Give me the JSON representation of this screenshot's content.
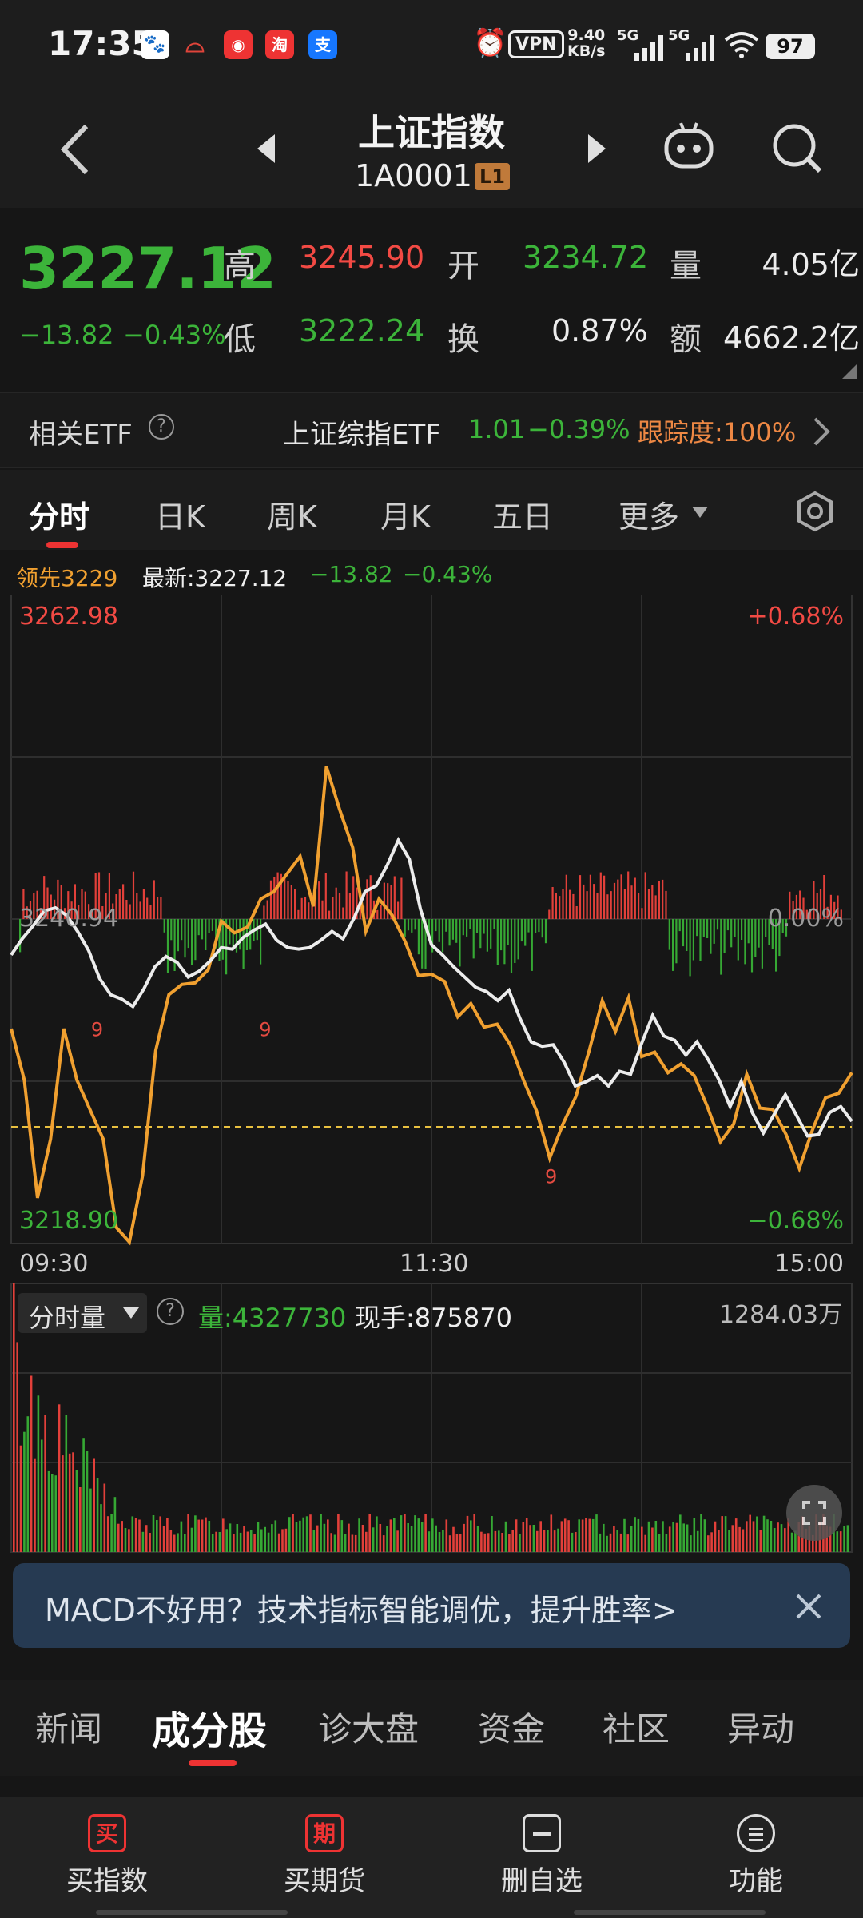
{
  "status_bar": {
    "time": "17:35",
    "vpn": "VPN",
    "net_speed_top": "9.40",
    "net_speed_bottom": "KB/s",
    "battery": "97",
    "net1": "5G",
    "net2": "5G"
  },
  "header": {
    "title": "上证指数",
    "code": "1A0001",
    "level_badge": "L1"
  },
  "quote": {
    "price": "3227.12",
    "change": "−13.82",
    "change_pct": "−0.43%",
    "high_label": "高",
    "high": "3245.90",
    "open_label": "开",
    "open": "3234.72",
    "volume_label": "量",
    "volume": "4.05亿",
    "low_label": "低",
    "low": "3222.24",
    "turnover_label": "换",
    "turnover": "0.87%",
    "amount_label": "额",
    "amount": "4662.2亿"
  },
  "etf": {
    "label": "相关ETF",
    "name": "上证综指ETF",
    "price": "1.01",
    "pct": "−0.39%",
    "tracking": "跟踪度:100%"
  },
  "tabs": [
    "分时",
    "日K",
    "周K",
    "月K",
    "五日",
    "更多"
  ],
  "chart_info": {
    "leading": "领先3229",
    "latest": "最新:3227.12",
    "change": "−13.82",
    "pct": "−0.43%"
  },
  "chart_labels": {
    "price_max": "3262.98",
    "price_mid": "3240.94",
    "price_min": "3218.90",
    "pct_max": "+0.68%",
    "pct_mid": "0.00%",
    "pct_min": "−0.68%",
    "time_start": "09:30",
    "time_mid": "11:30",
    "time_end": "15:00"
  },
  "volume_panel": {
    "selector": "分时量",
    "volume": "量:4327730",
    "current_hand": "现手:875870",
    "max_label": "1284.03万"
  },
  "banner": {
    "text": "MACD不好用？技术指标智能调优，提升胜率>"
  },
  "section_tabs": [
    "新闻",
    "成分股",
    "诊大盘",
    "资金",
    "社区",
    "异动"
  ],
  "bottom_bar": {
    "buy_index": "买指数",
    "buy_index_icon": "买",
    "buy_futures": "买期货",
    "buy_futures_icon": "期",
    "delete_watch": "删自选",
    "functions": "功能"
  },
  "colors": {
    "up": "#f24a44",
    "down": "#3cb43a",
    "avg_line": "#f0a030",
    "price_line": "#ececec",
    "banner_bg": "#263a52"
  },
  "chart_data": {
    "type": "line",
    "x_range": [
      "09:30",
      "15:00"
    ],
    "ylim": [
      3218.9,
      3262.98
    ],
    "prev_close": 3240.94,
    "series": [
      {
        "name": "最新",
        "values": [
          3238.5,
          3239.6,
          3240.5,
          3241.5,
          3241.7,
          3241.2,
          3240.1,
          3238.8,
          3236.9,
          3235.8,
          3235.5,
          3235.0,
          3236.2,
          3237.7,
          3238.4,
          3238.0,
          3237.0,
          3237.4,
          3238.1,
          3239.0,
          3238.9,
          3239.7,
          3240.2,
          3240.6,
          3239.5,
          3239.0,
          3238.9,
          3239.0,
          3239.5,
          3240.1,
          3239.6,
          3241.0,
          3242.8,
          3243.2,
          3244.6,
          3246.3,
          3245.0,
          3241.6,
          3239.2,
          3238.5,
          3237.7,
          3237.0,
          3236.3,
          3236.0,
          3235.4,
          3236.1,
          3234.2,
          3232.6,
          3232.3,
          3232.4,
          3231.2,
          3229.6,
          3229.9,
          3230.3,
          3229.6,
          3230.6,
          3230.4,
          3232.5,
          3234.4,
          3233.0,
          3232.7,
          3231.7,
          3232.6,
          3231.4,
          3230.0,
          3228.2,
          3229.9,
          3227.8,
          3226.4,
          3227.7,
          3229.0,
          3227.6,
          3226.2,
          3226.3,
          3227.8,
          3228.2,
          3227.2
        ]
      },
      {
        "name": "均价",
        "values": [
          3233.5,
          3230.0,
          3222.0,
          3226.0,
          3233.5,
          3230.0,
          3228.0,
          3226.0,
          3220.0,
          3219.0,
          3223.5,
          3232.0,
          3235.8,
          3236.5,
          3236.6,
          3237.5,
          3240.8,
          3240.0,
          3240.4,
          3242.3,
          3242.8,
          3244.0,
          3245.2,
          3241.8,
          3251.3,
          3248.4,
          3245.8,
          3240.1,
          3242.3,
          3241.2,
          3239.4,
          3237.1,
          3237.2,
          3236.7,
          3234.3,
          3235.2,
          3233.6,
          3233.8,
          3232.4,
          3230.0,
          3227.9,
          3224.7,
          3227.0,
          3228.9,
          3232.0,
          3235.4,
          3233.3,
          3235.6,
          3231.6,
          3231.9,
          3230.5,
          3231.1,
          3230.3,
          3228.2,
          3225.8,
          3227.0,
          3230.4,
          3228.1,
          3228.0,
          3226.3,
          3224.0,
          3226.6,
          3228.8,
          3229.1,
          3230.5
        ]
      }
    ]
  }
}
